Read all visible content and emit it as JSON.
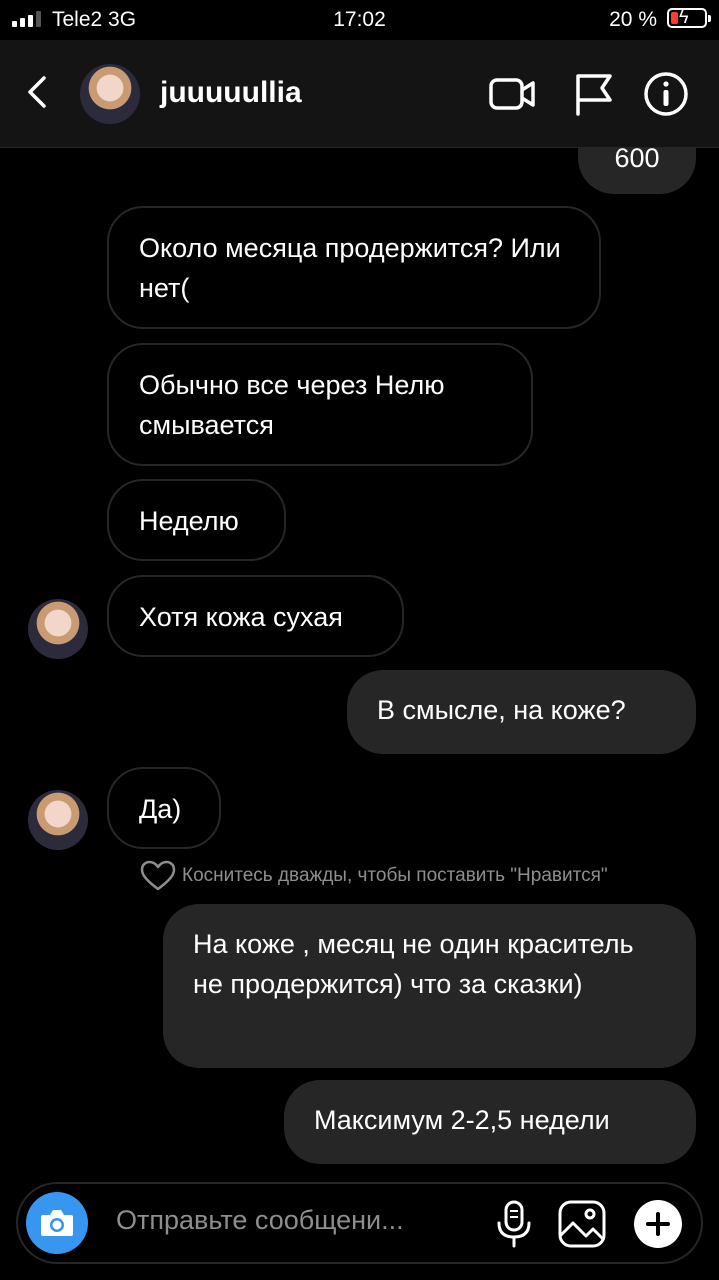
{
  "status_bar": {
    "carrier": "Tele2  3G",
    "time": "17:02",
    "battery": "20 %"
  },
  "header": {
    "username": "juuuuullia"
  },
  "messages": [
    {
      "from": "them",
      "text": "Около месяца продержится? Или нет("
    },
    {
      "from": "them",
      "text": "Обычно все через Нелю смывается"
    },
    {
      "from": "them",
      "text": "Неделю"
    },
    {
      "from": "them",
      "text": "Хотя кожа сухая"
    },
    {
      "from": "me",
      "text": "В смысле, на коже?"
    },
    {
      "from": "them",
      "text": "Да)"
    },
    {
      "from": "me",
      "text": "На коже , месяц не один краситель не продержится) что за сказки)"
    },
    {
      "from": "me",
      "text": "Максимум 2-2,5 недели"
    }
  ],
  "partial_message": "600",
  "like_hint": "Коснитесь дважды, чтобы поставить \"Нравится\"",
  "composer": {
    "placeholder": "Отправьте сообщени..."
  },
  "colors": {
    "accent": "#3797f0",
    "outgoing_bubble": "#262626",
    "background": "#000000"
  }
}
